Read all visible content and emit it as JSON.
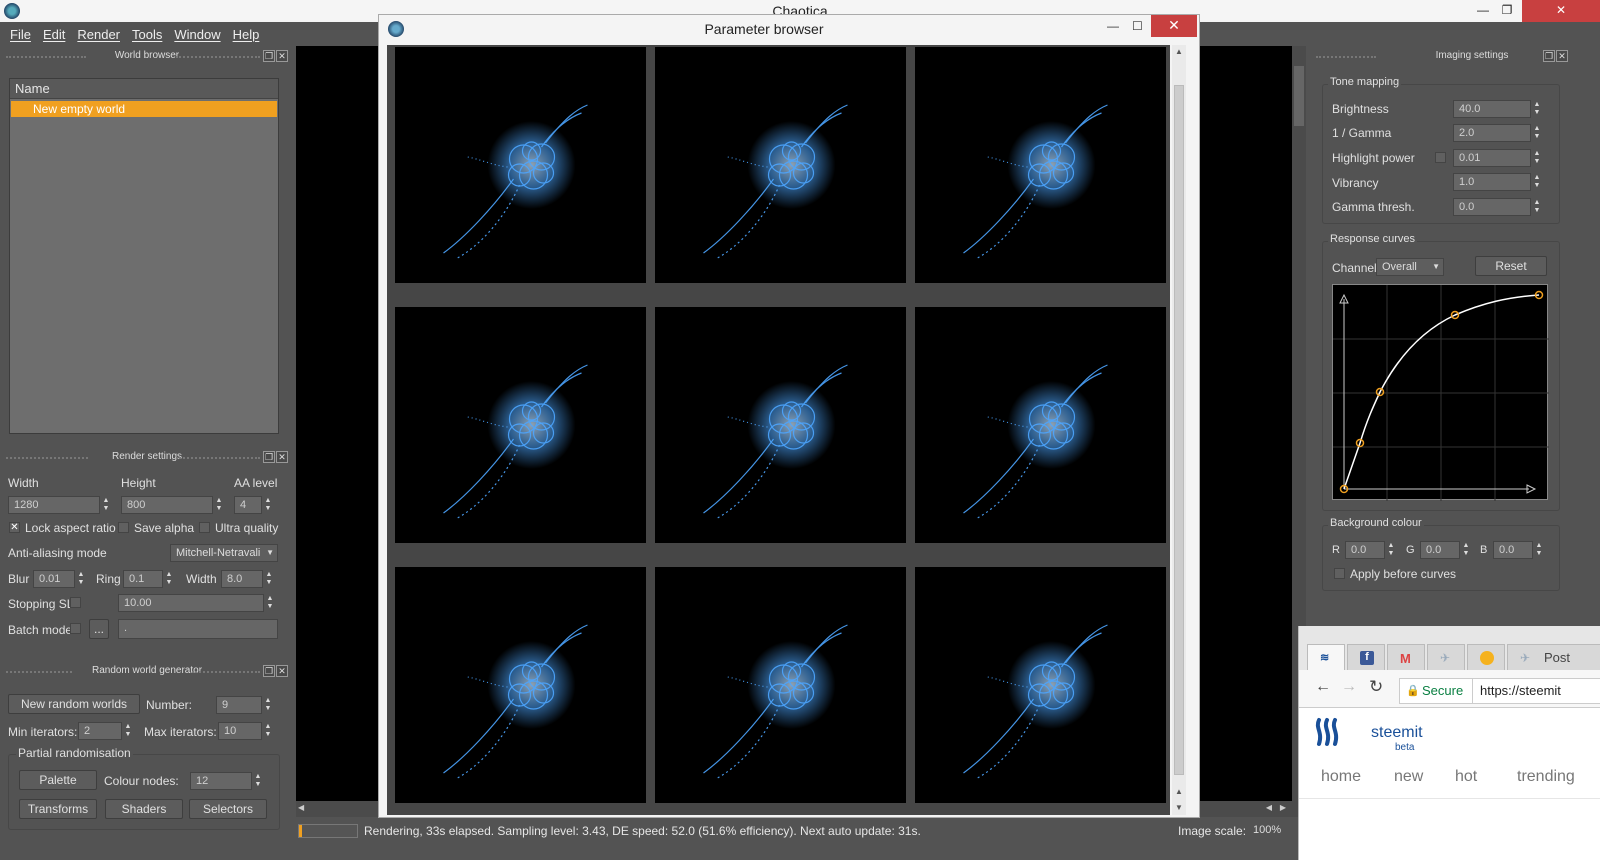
{
  "app": {
    "title": "Chaotica"
  },
  "menu": [
    "File",
    "Edit",
    "Render",
    "Tools",
    "Window",
    "Help"
  ],
  "world_browser": {
    "title": "World browser",
    "column": "Name",
    "items": [
      "New empty world"
    ]
  },
  "render_settings": {
    "title": "Render settings",
    "width_label": "Width",
    "width_value": "1280",
    "height_label": "Height",
    "height_value": "800",
    "aa_label": "AA level",
    "aa_value": "4",
    "lock_aspect": "Lock aspect ratio",
    "save_alpha": "Save alpha",
    "ultra_quality": "Ultra quality",
    "aa_mode_label": "Anti-aliasing mode",
    "aa_mode_value": "Mitchell-Netravali",
    "blur_label": "Blur",
    "blur_value": "0.01",
    "ring_label": "Ring",
    "ring_value": "0.1",
    "width2_label": "Width",
    "width2_value": "8.0",
    "stopping_label": "Stopping SL",
    "stopping_value": "10.00",
    "batch_label": "Batch mode",
    "batch_btn": "...",
    "batch_value": "."
  },
  "random_world": {
    "title": "Random world generator",
    "new_btn": "New random worlds",
    "number_label": "Number:",
    "number_value": "9",
    "min_label": "Min iterators:",
    "min_value": "2",
    "max_label": "Max iterators:",
    "max_value": "10",
    "partial_label": "Partial randomisation",
    "palette_btn": "Palette",
    "colour_nodes_label": "Colour nodes:",
    "colour_nodes_value": "12",
    "transforms_btn": "Transforms",
    "shaders_btn": "Shaders",
    "selectors_btn": "Selectors"
  },
  "parameter_browser": {
    "title": "Parameter browser",
    "thumbnails": 9
  },
  "imaging": {
    "title": "Imaging settings",
    "tone_title": "Tone mapping",
    "brightness_label": "Brightness",
    "brightness_value": "40.0",
    "gamma_label": "1 / Gamma",
    "gamma_value": "2.0",
    "highlight_label": "Highlight power",
    "highlight_value": "0.01",
    "vibrancy_label": "Vibrancy",
    "vibrancy_value": "1.0",
    "gamma_thresh_label": "Gamma thresh.",
    "gamma_thresh_value": "0.0",
    "curves_title": "Response curves",
    "channel_label": "Channel:",
    "channel_value": "Overall",
    "reset_btn": "Reset",
    "bg_title": "Background colour",
    "r_label": "R",
    "r_value": "0.0",
    "g_label": "G",
    "g_value": "0.0",
    "b_label": "B",
    "b_value": "0.0",
    "apply_label": "Apply before curves"
  },
  "status": {
    "text": "Rendering, 33s elapsed. Sampling level: 3.43, DE speed: 52.0 (51.6% efficiency). Next auto update: 31s.",
    "progress": 0.05,
    "scale_label": "Image scale:",
    "scale_value": "100%"
  },
  "browser": {
    "tab_label": "Post",
    "secure": "Secure",
    "url": "https://steemit",
    "brand": "steemit",
    "brand_sub": "beta",
    "nav": [
      "home",
      "new",
      "hot",
      "trending"
    ]
  },
  "colors": {
    "accent": "#f0a020",
    "panel": "#535353",
    "fractal": "#4da6ff"
  }
}
